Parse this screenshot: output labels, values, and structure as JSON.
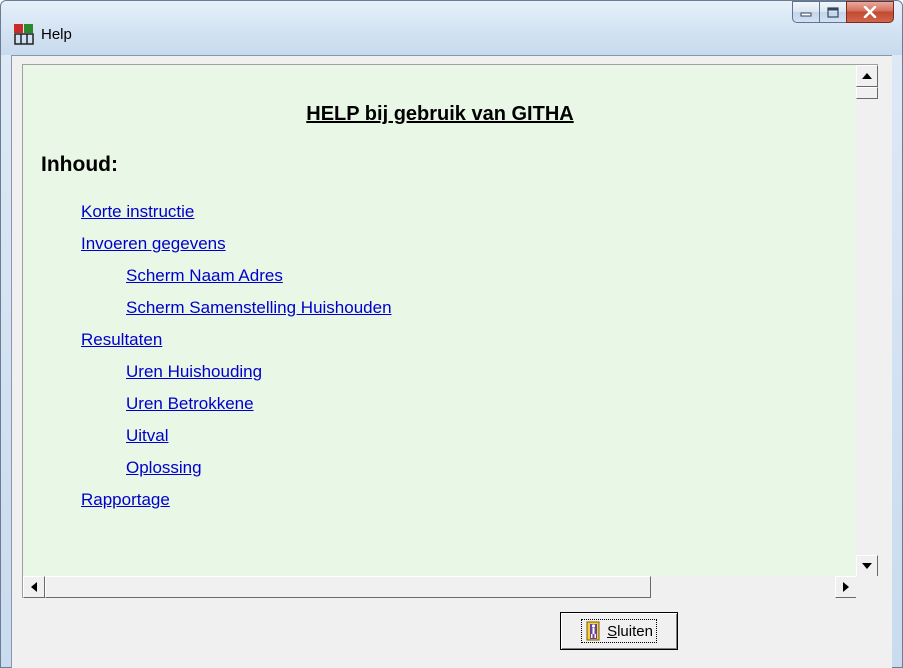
{
  "window": {
    "title": "Help"
  },
  "content": {
    "heading": "HELP bij gebruik van GITHA",
    "toc_title": "Inhoud:",
    "links": [
      {
        "label": "Korte instructie"
      },
      {
        "label": "Invoeren gegevens"
      },
      {
        "label": "Scherm Naam Adres"
      },
      {
        "label": "Scherm Samenstelling Huishouden"
      },
      {
        "label": "Resultaten"
      },
      {
        "label": "Uren Huishouding"
      },
      {
        "label": "Uren Betrokkene"
      },
      {
        "label": "Uitval"
      },
      {
        "label": "Oplossing"
      },
      {
        "label": "Rapportage"
      }
    ]
  },
  "footer": {
    "close_button_label_first": "S",
    "close_button_label_rest": "luiten"
  },
  "colors": {
    "content_bg": "#e9f7e6",
    "link": "#0000cc"
  }
}
